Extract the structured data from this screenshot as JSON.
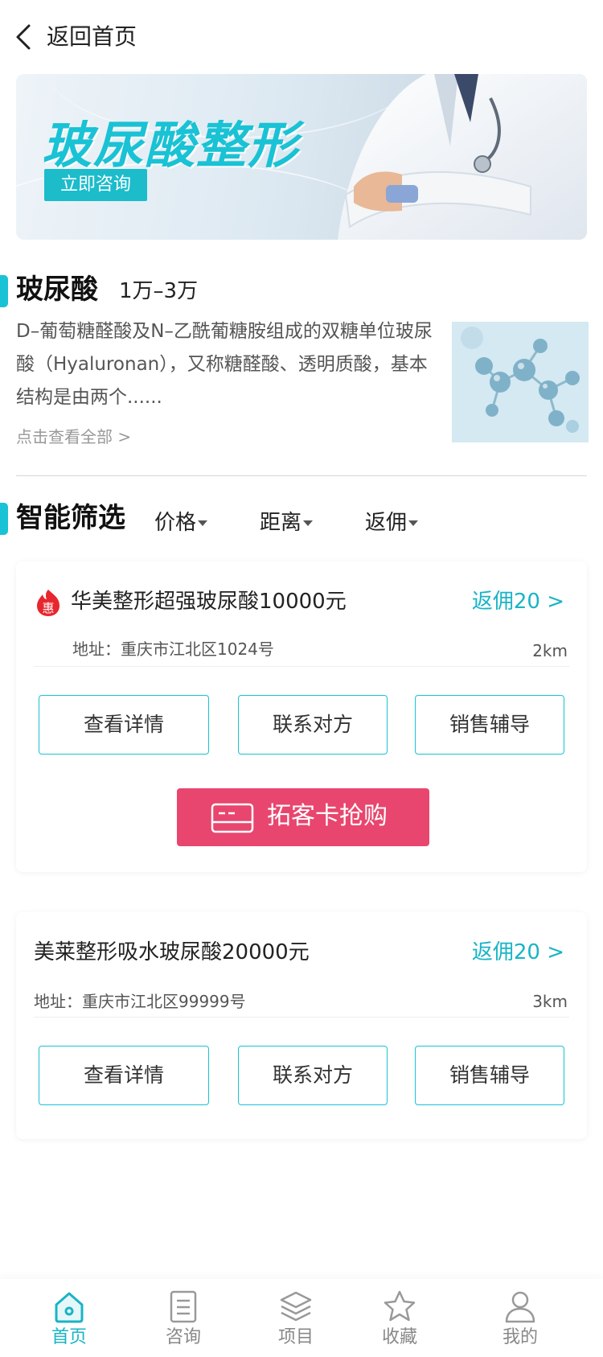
{
  "topbar": {
    "back_label": "返回首页"
  },
  "banner": {
    "title": "玻尿酸整形",
    "button": "立即咨询"
  },
  "intro": {
    "title": "玻尿酸",
    "price_range": "1万–3万",
    "description": "D–葡萄糖醛酸及N–乙酰葡糖胺组成的双糖单位玻尿酸（Hyaluronan），又称糖醛酸、透明质酸，基本结构是由两个......",
    "see_all": "点击查看全部 >"
  },
  "filter": {
    "title": "智能筛选",
    "options": [
      "价格",
      "距离",
      "返佣"
    ]
  },
  "listings": [
    {
      "title": "华美整形超强玻尿酸10000元",
      "badge": "惠",
      "rebate": "返佣20 >",
      "address": "地址：重庆市江北区1024号",
      "distance": "2km",
      "buttons": [
        "查看详情",
        "联系对方",
        "销售辅导"
      ],
      "buy_label": "拓客卡抢购"
    },
    {
      "title": "美莱整形吸水玻尿酸20000元",
      "rebate": "返佣20 >",
      "address": "地址：重庆市江北区99999号",
      "distance": "3km",
      "buttons": [
        "查看详情",
        "联系对方",
        "销售辅导"
      ]
    }
  ],
  "tabbar": {
    "items": [
      {
        "label": "首页",
        "icon": "home-icon",
        "active": true
      },
      {
        "label": "咨询",
        "icon": "document-icon",
        "active": false
      },
      {
        "label": "项目",
        "icon": "layers-icon",
        "active": false
      },
      {
        "label": "收藏",
        "icon": "star-icon",
        "active": false
      },
      {
        "label": "我的",
        "icon": "user-icon",
        "active": false
      }
    ]
  },
  "colors": {
    "accent": "#19c2d4",
    "buy_button": "#e8466e",
    "rebate_text": "#19b4c6"
  }
}
